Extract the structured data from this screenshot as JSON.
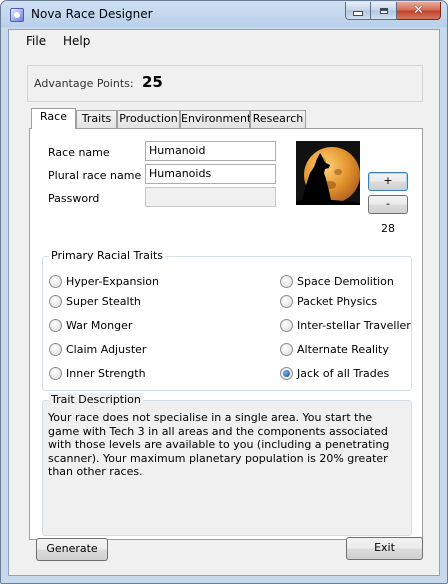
{
  "window": {
    "title": "Nova Race Designer",
    "close_glyph": "✕"
  },
  "menu": {
    "items": [
      "File",
      "Help"
    ]
  },
  "advantage": {
    "label": "Advantage Points:",
    "value": "25"
  },
  "tabs": [
    "Race",
    "Traits",
    "Production",
    "Environment",
    "Research"
  ],
  "race": {
    "name_label": "Race name",
    "name_value": "Humanoid",
    "plural_label": "Plural race name",
    "plural_value": "Humanoids",
    "password_label": "Password",
    "password_value": "",
    "portrait_icon": "wolf-moon-portrait",
    "plus_label": "+",
    "minus_label": "-",
    "portrait_number": "28"
  },
  "traits": {
    "group_title": "Primary Racial Traits",
    "options": [
      {
        "label": "Hyper-Expansion",
        "checked": false
      },
      {
        "label": "Super Stealth",
        "checked": false
      },
      {
        "label": "War Monger",
        "checked": false
      },
      {
        "label": "Claim Adjuster",
        "checked": false
      },
      {
        "label": "Inner Strength",
        "checked": false
      },
      {
        "label": "Space Demolition",
        "checked": false
      },
      {
        "label": "Packet Physics",
        "checked": false
      },
      {
        "label": "Inter-stellar Traveller",
        "checked": false
      },
      {
        "label": "Alternate Reality",
        "checked": false
      },
      {
        "label": "Jack of all Trades",
        "checked": true
      }
    ]
  },
  "description": {
    "title": "Trait Description",
    "text": "Your race does not specialise in a single area. You start the game with Tech 3 in all areas and the components associated with those levels are available to you (including a penetrating scanner). Your maximum planetary population is 20% greater than other races."
  },
  "footer": {
    "generate_label": "Generate",
    "exit_label": "Exit"
  },
  "colors": {
    "accent": "#3c7fb1",
    "title_bar": "#b9d0ea",
    "close_button": "#c0412a"
  }
}
